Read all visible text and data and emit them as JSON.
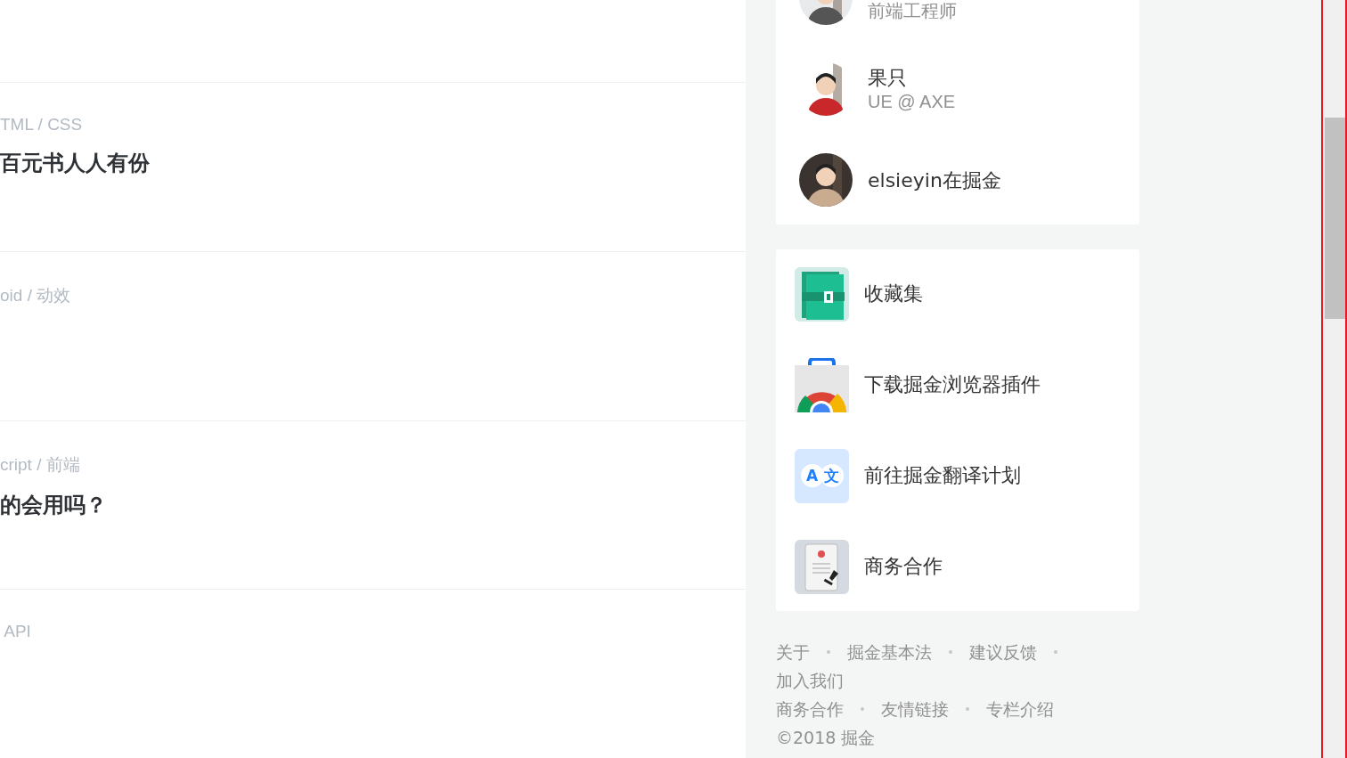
{
  "articles": [
    {
      "tag": "TML / CSS",
      "title": "百元书人人有份"
    },
    {
      "tag": "oid / 动效"
    },
    {
      "tag": "cript / 前端",
      "title": "的会用吗？"
    },
    {
      "tag": " API"
    }
  ],
  "authors": [
    {
      "subtitle": "前端工程师"
    },
    {
      "name": "果只",
      "subtitle": "UE @ AXE"
    },
    {
      "name": "elsieyin在掘金"
    }
  ],
  "links": [
    {
      "kind": "collection",
      "label": "收藏集"
    },
    {
      "kind": "extension",
      "label": "下载掘金浏览器插件"
    },
    {
      "kind": "translate",
      "label": "前往掘金翻译计划",
      "glyphs": [
        "A",
        "文"
      ]
    },
    {
      "kind": "business",
      "label": "商务合作"
    }
  ],
  "footer": {
    "groups": [
      [
        "关于",
        "掘金基本法",
        "建议反馈",
        "加入我们"
      ],
      [
        "商务合作",
        "友情链接",
        "专栏介绍"
      ]
    ],
    "copyright": "©2018 掘金"
  }
}
